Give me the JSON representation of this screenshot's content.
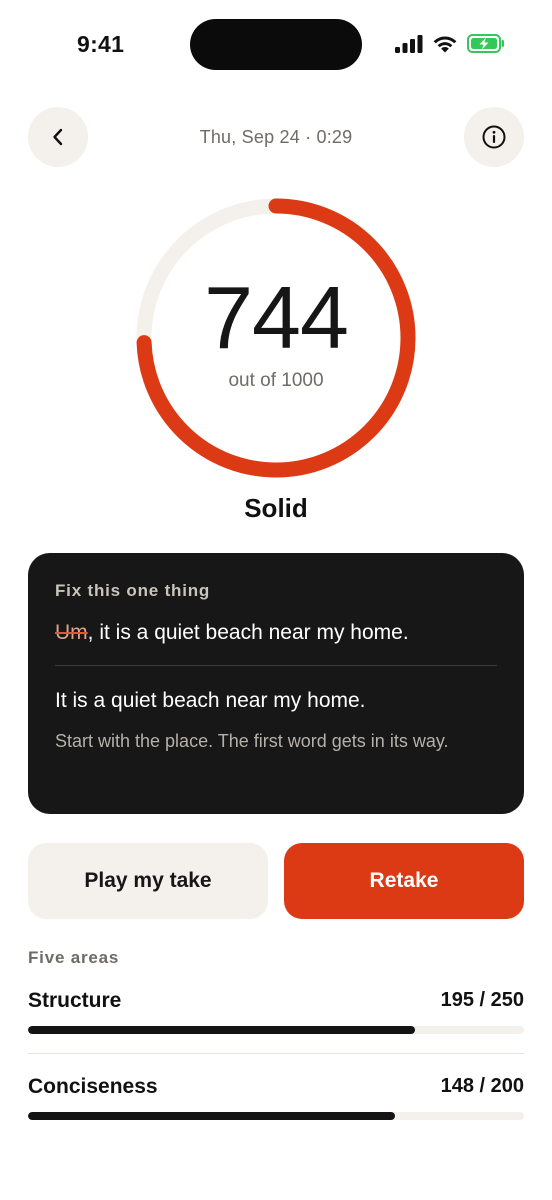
{
  "status_bar": {
    "time": "9:41",
    "icons": [
      "signal-icon",
      "wifi-icon",
      "battery-charging-icon"
    ],
    "battery_color": "#34c759"
  },
  "header": {
    "session_meta": "Thu, Sep 24 · 0:29",
    "back_icon": "chevron-left-icon",
    "info_icon": "info-icon"
  },
  "score": {
    "value": "744",
    "max_label": "out of 1000",
    "fraction": 0.744,
    "rating": "Solid",
    "ring_color": "#dc3a14",
    "track_color": "#f4f1ec"
  },
  "tip": {
    "eyebrow": "Fix this one thing",
    "original_struck": "Um",
    "original_rest": ", it is a quiet beach near my home.",
    "fixed": "It is a quiet beach near my home.",
    "hint": "Start with the place. The first word gets in its way."
  },
  "actions": {
    "play_label": "Play my take",
    "retake_label": "Retake"
  },
  "areas": {
    "heading": "Five areas",
    "items": [
      {
        "name": "Structure",
        "score_label": "195 / 250",
        "score": 195,
        "max": 250
      },
      {
        "name": "Conciseness",
        "score_label": "148 / 200",
        "score": 148,
        "max": 200
      }
    ]
  },
  "colors": {
    "accent": "#dc3a14",
    "card_bg": "#171717",
    "chip_bg": "#f4f1ec"
  }
}
